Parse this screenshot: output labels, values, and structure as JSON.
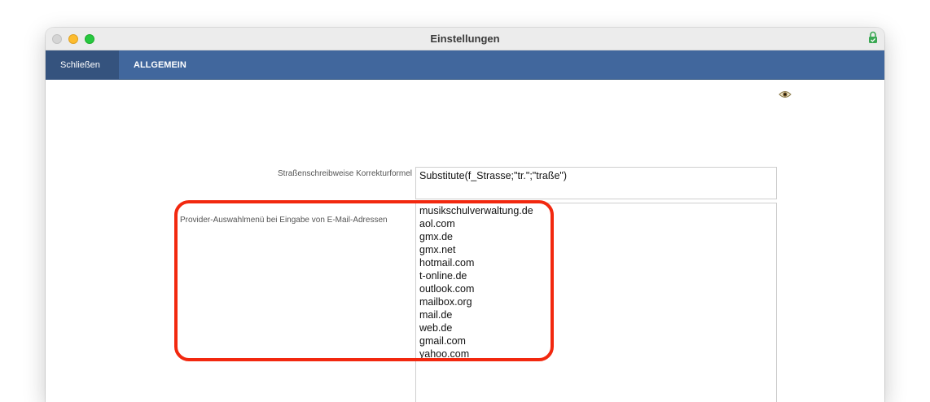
{
  "window": {
    "title": "Einstellungen"
  },
  "menubar": {
    "close_label": "Schließen",
    "tab_label": "ALLGEMEIN",
    "background": "#41679d"
  },
  "form": {
    "strasse": {
      "label": "Straßenschreibweise Korrekturformel",
      "value": "Substitute(f_Strasse;\"tr.\";\"traße\")"
    },
    "provider": {
      "label": "Provider-Auswahlmenü bei Eingabe von E-Mail-Adressen",
      "items": [
        "musikschulverwaltung.de",
        "aol.com",
        "gmx.de",
        "gmx.net",
        "hotmail.com",
        "t-online.de",
        "outlook.com",
        "mailbox.org",
        "mail.de",
        "web.de",
        "gmail.com",
        "yahoo.com"
      ]
    }
  },
  "icons": {
    "lock": "lock-icon",
    "eye": "eye-icon"
  },
  "colors": {
    "highlight": "#f2280f",
    "accent": "#41679d"
  }
}
